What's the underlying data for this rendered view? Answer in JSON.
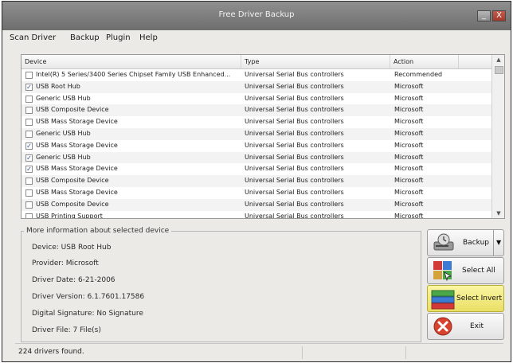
{
  "window": {
    "title": "Free Driver Backup",
    "minimize_glyph": "_",
    "close_glyph": "X"
  },
  "menu": [
    "Scan Driver",
    "Backup",
    "Plugin",
    "Help"
  ],
  "table": {
    "columns": [
      "Device",
      "Type",
      "Action"
    ],
    "rows": [
      {
        "checked": false,
        "device": "Intel(R) 5 Series/3400 Series Chipset Family USB Enhanced...",
        "type": "Universal Serial Bus controllers",
        "action": "Recommended"
      },
      {
        "checked": true,
        "device": "USB Root Hub",
        "type": "Universal Serial Bus controllers",
        "action": "Microsoft"
      },
      {
        "checked": false,
        "device": "Generic USB Hub",
        "type": "Universal Serial Bus controllers",
        "action": "Microsoft"
      },
      {
        "checked": false,
        "device": "USB Composite Device",
        "type": "Universal Serial Bus controllers",
        "action": "Microsoft"
      },
      {
        "checked": false,
        "device": "USB Mass Storage Device",
        "type": "Universal Serial Bus controllers",
        "action": "Microsoft"
      },
      {
        "checked": false,
        "device": "Generic USB Hub",
        "type": "Universal Serial Bus controllers",
        "action": "Microsoft"
      },
      {
        "checked": true,
        "device": "USB Mass Storage Device",
        "type": "Universal Serial Bus controllers",
        "action": "Microsoft"
      },
      {
        "checked": true,
        "device": "Generic USB Hub",
        "type": "Universal Serial Bus controllers",
        "action": "Microsoft"
      },
      {
        "checked": true,
        "device": "USB Mass Storage Device",
        "type": "Universal Serial Bus controllers",
        "action": "Microsoft"
      },
      {
        "checked": false,
        "device": "USB Composite Device",
        "type": "Universal Serial Bus controllers",
        "action": "Microsoft"
      },
      {
        "checked": false,
        "device": "USB Mass Storage Device",
        "type": "Universal Serial Bus controllers",
        "action": "Microsoft"
      },
      {
        "checked": false,
        "device": "USB Composite Device",
        "type": "Universal Serial Bus controllers",
        "action": "Microsoft"
      },
      {
        "checked": false,
        "device": "USB Printing Support",
        "type": "Universal Serial Bus controllers",
        "action": "Microsoft"
      }
    ]
  },
  "info": {
    "legend": "More information about selected device",
    "device": "Device:  USB Root Hub",
    "provider": "Provider: Microsoft",
    "date": "Driver Date: 6-21-2006",
    "version": "Driver Version: 6.1.7601.17586",
    "signature": "Digital Signature: No Signature",
    "file": "Driver File: 7 File(s)"
  },
  "buttons": {
    "backup": "Backup",
    "select_all": "Select All",
    "select_invert": "Select Invert",
    "exit": "Exit"
  },
  "status": "224 drivers found."
}
